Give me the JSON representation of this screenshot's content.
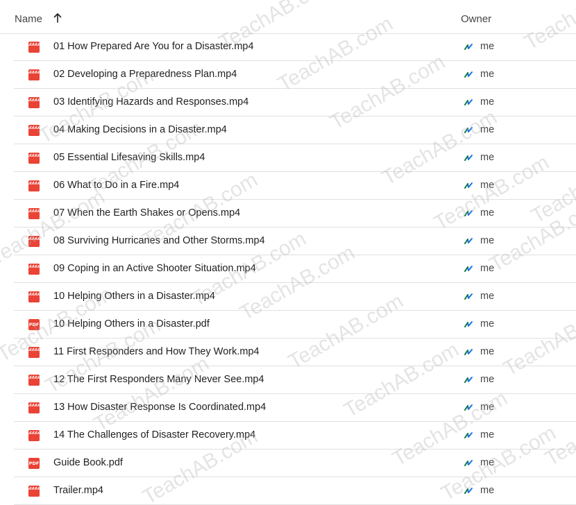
{
  "header": {
    "name_label": "Name",
    "owner_label": "Owner",
    "sort_icon": "arrow-up-icon"
  },
  "files": [
    {
      "name": "01 How Prepared Are You for a Disaster.mp4",
      "type": "video",
      "owner": "me"
    },
    {
      "name": "02 Developing a Preparedness Plan.mp4",
      "type": "video",
      "owner": "me"
    },
    {
      "name": "03 Identifying Hazards and Responses.mp4",
      "type": "video",
      "owner": "me"
    },
    {
      "name": "04 Making Decisions in a Disaster.mp4",
      "type": "video",
      "owner": "me"
    },
    {
      "name": "05 Essential Lifesaving Skills.mp4",
      "type": "video",
      "owner": "me"
    },
    {
      "name": "06 What to Do in a Fire.mp4",
      "type": "video",
      "owner": "me"
    },
    {
      "name": "07 When the Earth Shakes or Opens.mp4",
      "type": "video",
      "owner": "me"
    },
    {
      "name": "08 Surviving Hurricanes and Other Storms.mp4",
      "type": "video",
      "owner": "me"
    },
    {
      "name": "09 Coping in an Active Shooter Situation.mp4",
      "type": "video",
      "owner": "me"
    },
    {
      "name": "10 Helping Others in a Disaster.mp4",
      "type": "video",
      "owner": "me"
    },
    {
      "name": "10 Helping Others in a Disaster.pdf",
      "type": "pdf",
      "owner": "me"
    },
    {
      "name": "11 First Responders and How They Work.mp4",
      "type": "video",
      "owner": "me"
    },
    {
      "name": "12 The First Responders Many Never See.mp4",
      "type": "video",
      "owner": "me"
    },
    {
      "name": "13 How Disaster Response Is Coordinated.mp4",
      "type": "video",
      "owner": "me"
    },
    {
      "name": "14 The Challenges of Disaster Recovery.mp4",
      "type": "video",
      "owner": "me"
    },
    {
      "name": "Guide Book.pdf",
      "type": "pdf",
      "owner": "me"
    },
    {
      "name": "Trailer.mp4",
      "type": "video",
      "owner": "me"
    }
  ],
  "icons": {
    "video": "video-file-icon",
    "pdf": "pdf-file-icon",
    "pdf_label": "PDF",
    "owner": "shared-drive-owner-icon"
  },
  "colors": {
    "file_icon_red": "#ea4335",
    "owner_icon_green": "#188038",
    "owner_icon_blue": "#1a73e8"
  },
  "watermark": {
    "text": "TeachAB.com"
  }
}
